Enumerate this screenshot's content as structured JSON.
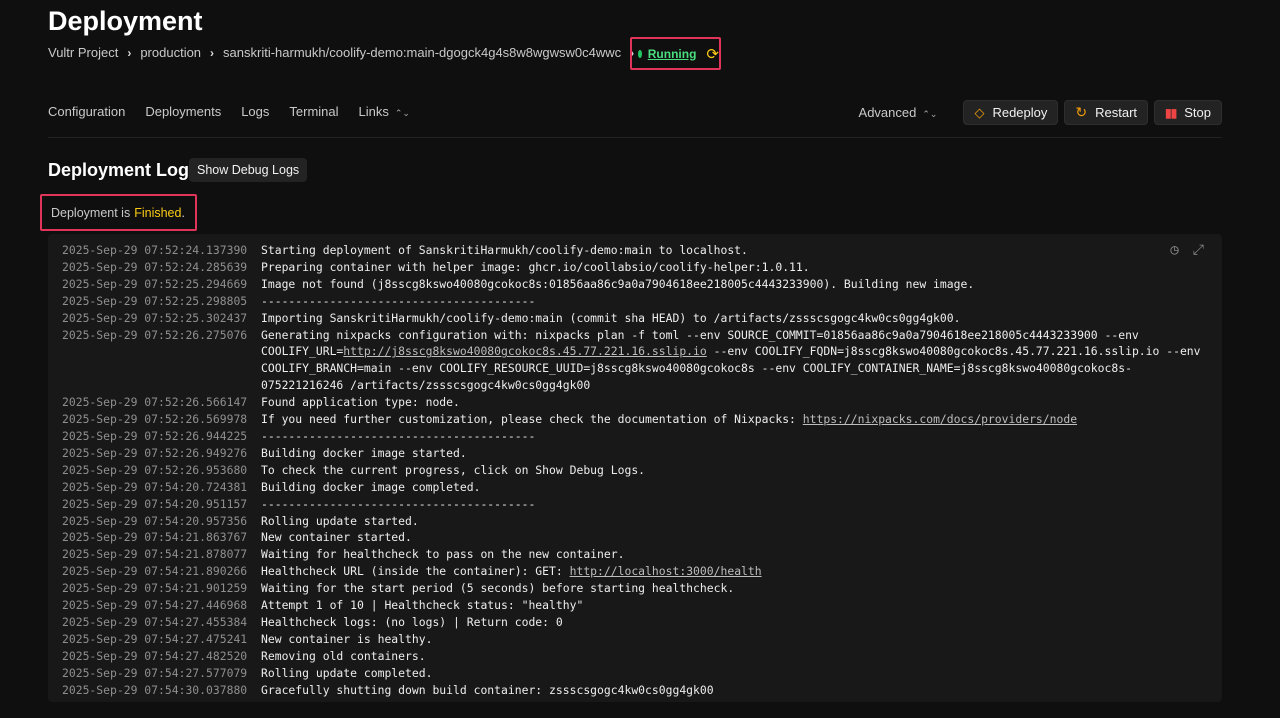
{
  "header": {
    "title": "Deployment",
    "breadcrumb": [
      "Vultr Project",
      "production",
      "sanskriti-harmukh/coolify-demo:main-dgogck4g4s8w8wgwsw0c4wwc"
    ],
    "status": "Running",
    "status_color": "#4ade80"
  },
  "nav": {
    "tabs": [
      "Configuration",
      "Deployments",
      "Logs",
      "Terminal",
      "Links"
    ],
    "advanced": "Advanced",
    "redeploy": "Redeploy",
    "restart": "Restart",
    "stop": "Stop"
  },
  "log_section": {
    "title": "Deployment Log",
    "debug_button": "Show Debug Logs",
    "status_prefix": "Deployment is",
    "status_value": "Finished",
    "status_suffix": "."
  },
  "log_lines": [
    {
      "ts": "2025-Sep-29 07:52:24.137390",
      "msg": "Starting deployment of SanskritiHarmukh/coolify-demo:main to localhost."
    },
    {
      "ts": "2025-Sep-29 07:52:24.285639",
      "msg": "Preparing container with helper image: ghcr.io/coollabsio/coolify-helper:1.0.11."
    },
    {
      "ts": "2025-Sep-29 07:52:25.294669",
      "msg": "Image not found (j8sscg8kswo40080gcokoc8s:01856aa86c9a0a7904618ee218005c4443233900). Building new image."
    },
    {
      "ts": "2025-Sep-29 07:52:25.298805",
      "msg": "----------------------------------------"
    },
    {
      "ts": "2025-Sep-29 07:52:25.302437",
      "msg": "Importing SanskritiHarmukh/coolify-demo:main (commit sha HEAD) to /artifacts/zssscsgogc4kw0cs0gg4gk00."
    },
    {
      "ts": "2025-Sep-29 07:52:26.275076",
      "msg": "Generating nixpacks configuration with: nixpacks plan -f toml --env SOURCE_COMMIT=01856aa86c9a0a7904618ee218005c4443233900 --env COOLIFY_URL=http://j8sscg8kswo40080gcokoc8s.45.77.221.16.sslip.io --env COOLIFY_FQDN=j8sscg8kswo40080gcokoc8s.45.77.221.16.sslip.io --env COOLIFY_BRANCH=main --env COOLIFY_RESOURCE_UUID=j8sscg8kswo40080gcokoc8s --env COOLIFY_CONTAINER_NAME=j8sscg8kswo40080gcokoc8s-075221216246 /artifacts/zssscsgogc4kw0cs0gg4gk00"
    },
    {
      "ts": "2025-Sep-29 07:52:26.566147",
      "msg": "Found application type: node."
    },
    {
      "ts": "2025-Sep-29 07:52:26.569978",
      "msg": "If you need further customization, please check the documentation of Nixpacks: https://nixpacks.com/docs/providers/node"
    },
    {
      "ts": "2025-Sep-29 07:52:26.944225",
      "msg": "----------------------------------------"
    },
    {
      "ts": "2025-Sep-29 07:52:26.949276",
      "msg": "Building docker image started."
    },
    {
      "ts": "2025-Sep-29 07:52:26.953680",
      "msg": "To check the current progress, click on Show Debug Logs."
    },
    {
      "ts": "2025-Sep-29 07:54:20.724381",
      "msg": "Building docker image completed."
    },
    {
      "ts": "2025-Sep-29 07:54:20.951157",
      "msg": "----------------------------------------"
    },
    {
      "ts": "2025-Sep-29 07:54:20.957356",
      "msg": "Rolling update started."
    },
    {
      "ts": "2025-Sep-29 07:54:21.863767",
      "msg": "New container started."
    },
    {
      "ts": "2025-Sep-29 07:54:21.878077",
      "msg": "Waiting for healthcheck to pass on the new container."
    },
    {
      "ts": "2025-Sep-29 07:54:21.890266",
      "msg": "Healthcheck URL (inside the container): GET: http://localhost:3000/health"
    },
    {
      "ts": "2025-Sep-29 07:54:21.901259",
      "msg": "Waiting for the start period (5 seconds) before starting healthcheck."
    },
    {
      "ts": "2025-Sep-29 07:54:27.446968",
      "msg": "Attempt 1 of 10 | Healthcheck status: \"healthy\""
    },
    {
      "ts": "2025-Sep-29 07:54:27.455384",
      "msg": "Healthcheck logs: (no logs) | Return code: 0"
    },
    {
      "ts": "2025-Sep-29 07:54:27.475241",
      "msg": "New container is healthy."
    },
    {
      "ts": "2025-Sep-29 07:54:27.482520",
      "msg": "Removing old containers."
    },
    {
      "ts": "2025-Sep-29 07:54:27.577079",
      "msg": "Rolling update completed."
    },
    {
      "ts": "2025-Sep-29 07:54:30.037880",
      "msg": "Gracefully shutting down build container: zssscsgogc4kw0cs0gg4gk00"
    }
  ]
}
